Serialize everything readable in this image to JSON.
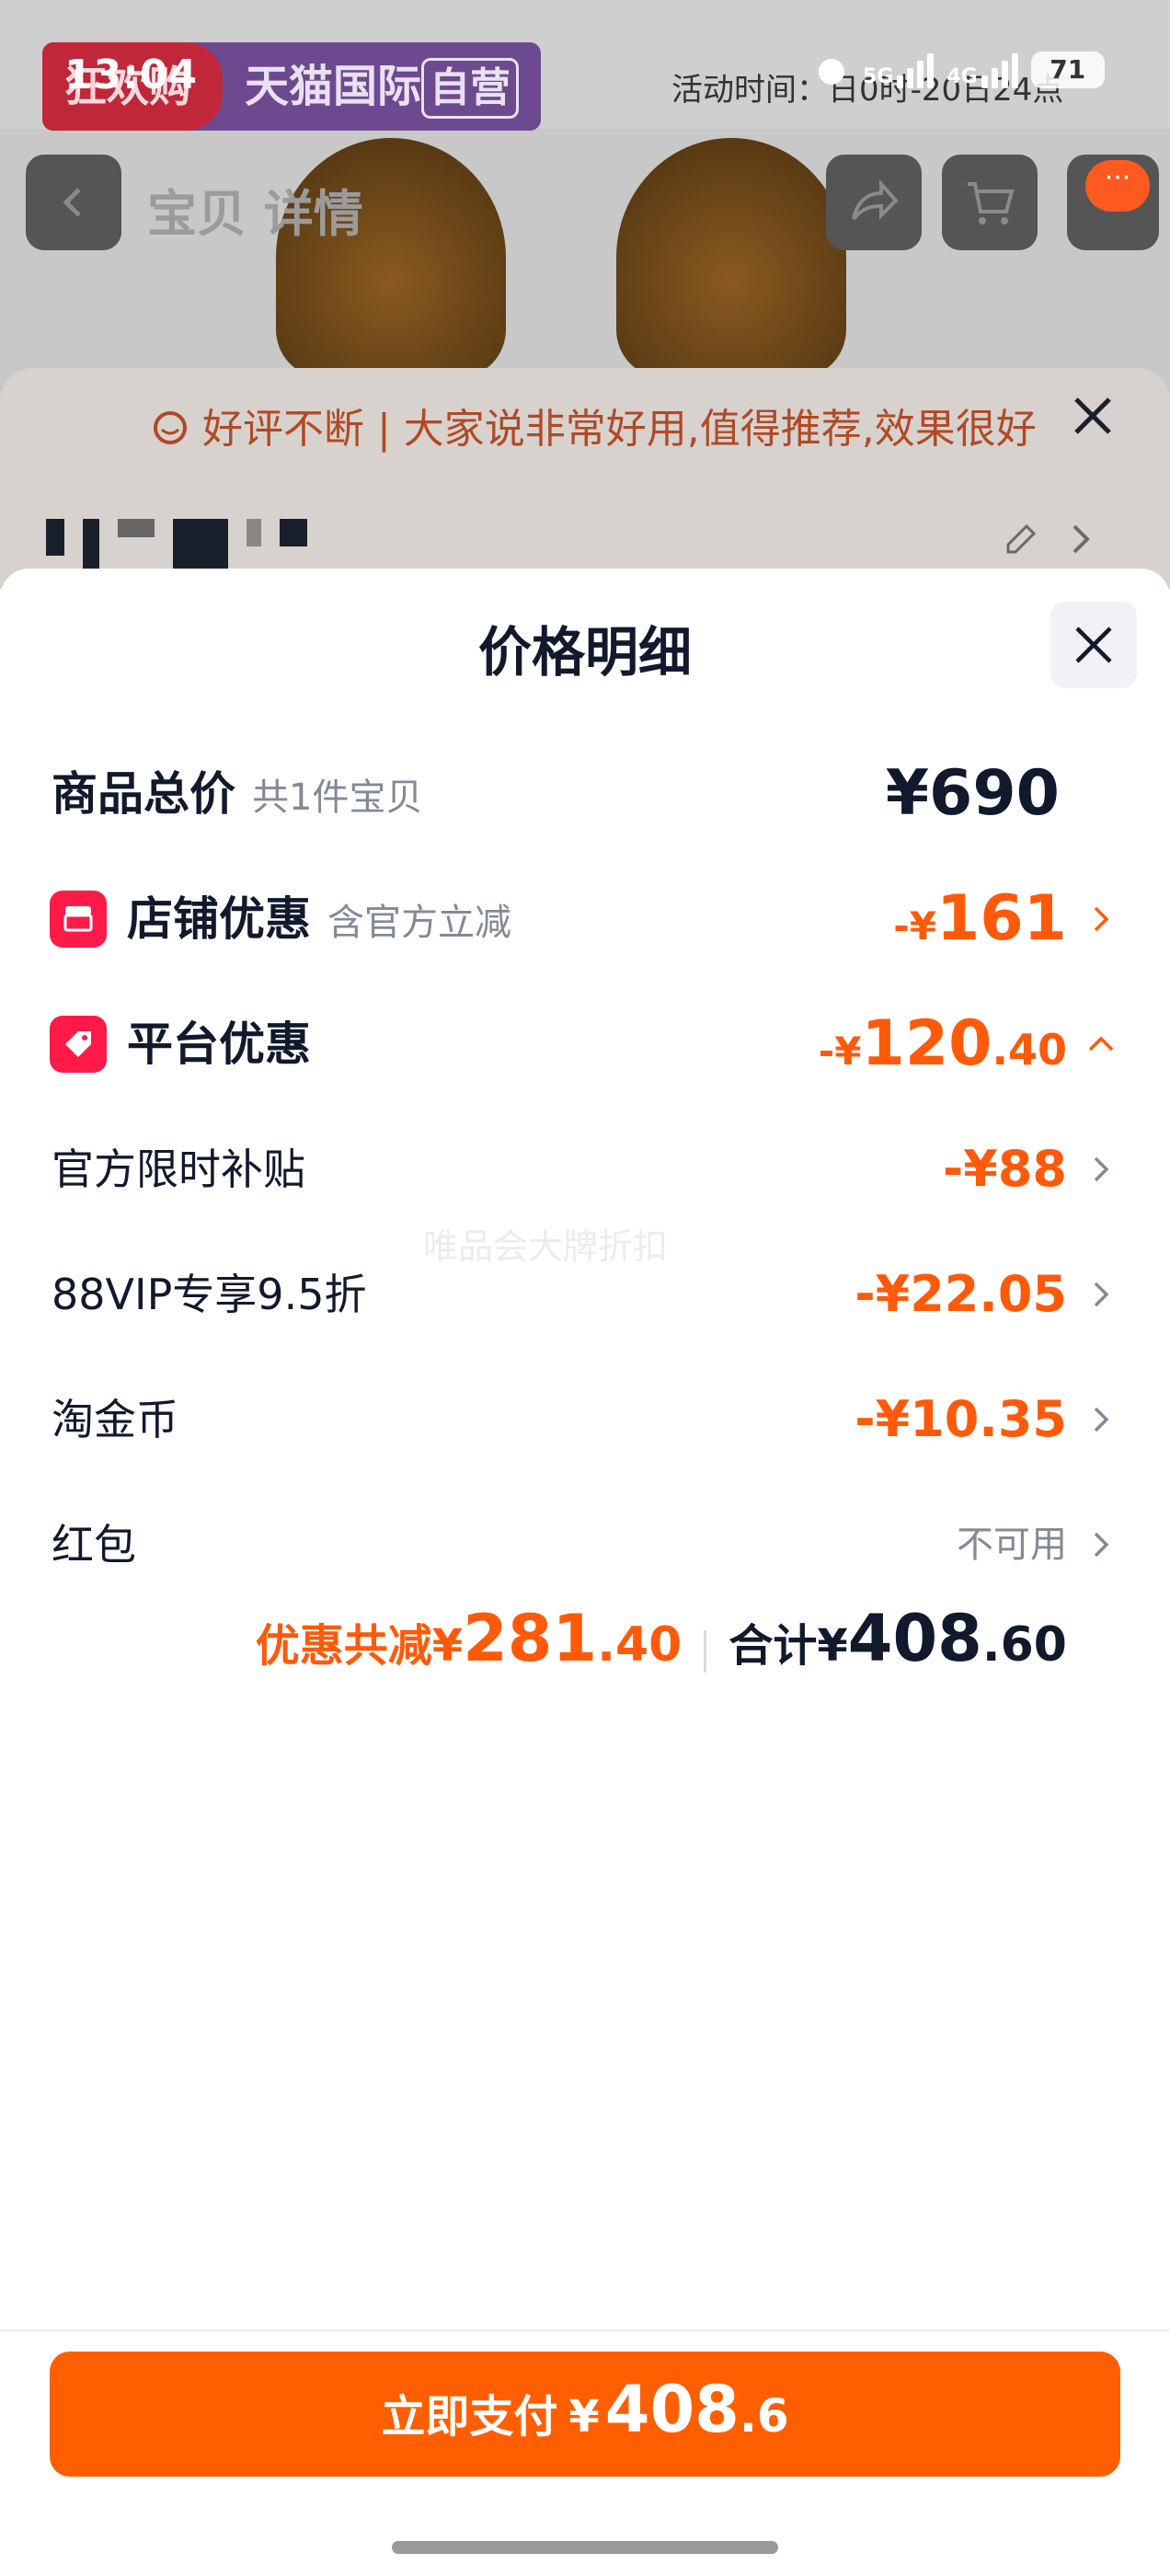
{
  "status_bar": {
    "time": "13:04",
    "net_5g": "5G",
    "net_4g": "4G",
    "battery": "71"
  },
  "background": {
    "banner_left": "狂欢购",
    "banner_right": "天猫国际",
    "banner_tag": "自营",
    "activity_text": "活动时间：日0时-20日24点",
    "nav_title": "宝贝 详情",
    "review_text": "好评不断 | 大家说非常好用,值得推荐,效果很好"
  },
  "sheet": {
    "title": "价格明细",
    "rows": [
      {
        "label": "商品总价",
        "note": "共1件宝贝",
        "value": "¥690"
      },
      {
        "label": "店铺优惠",
        "note": "含官方立减",
        "value_prefix": "-¥",
        "value_int": "161",
        "value_dec": ""
      },
      {
        "label": "平台优惠",
        "note": "",
        "value_prefix": "-¥",
        "value_int": "120",
        "value_dec": ".40"
      },
      {
        "label": "官方限时补贴",
        "value": "-¥88"
      },
      {
        "label": "88VIP专享9.5折",
        "value": "-¥22.05"
      },
      {
        "label": "淘金币",
        "value": "-¥10.35"
      },
      {
        "label": "红包",
        "value": "不可用"
      }
    ],
    "watermark": "唯品会大牌折扣",
    "summary": {
      "discount_label": "优惠共减¥",
      "discount_int": "281",
      "discount_dec": ".40",
      "total_label": "合计¥",
      "total_int": "408",
      "total_dec": ".60"
    },
    "pay_button": {
      "label": "立即支付",
      "currency": "¥",
      "amount_int": "408",
      "amount_dec": ".6"
    }
  },
  "colors": {
    "accent": "#ff5a0a",
    "pay_button": "#ff5f00",
    "coupon_icon": "#ff1a48"
  },
  "icons": [
    "back-icon",
    "share-icon",
    "cart-icon",
    "more-icon",
    "chat-bubble-icon",
    "close-icon",
    "edit-icon",
    "shop-icon",
    "tag-icon",
    "chevron-right-icon",
    "chevron-up-icon"
  ]
}
